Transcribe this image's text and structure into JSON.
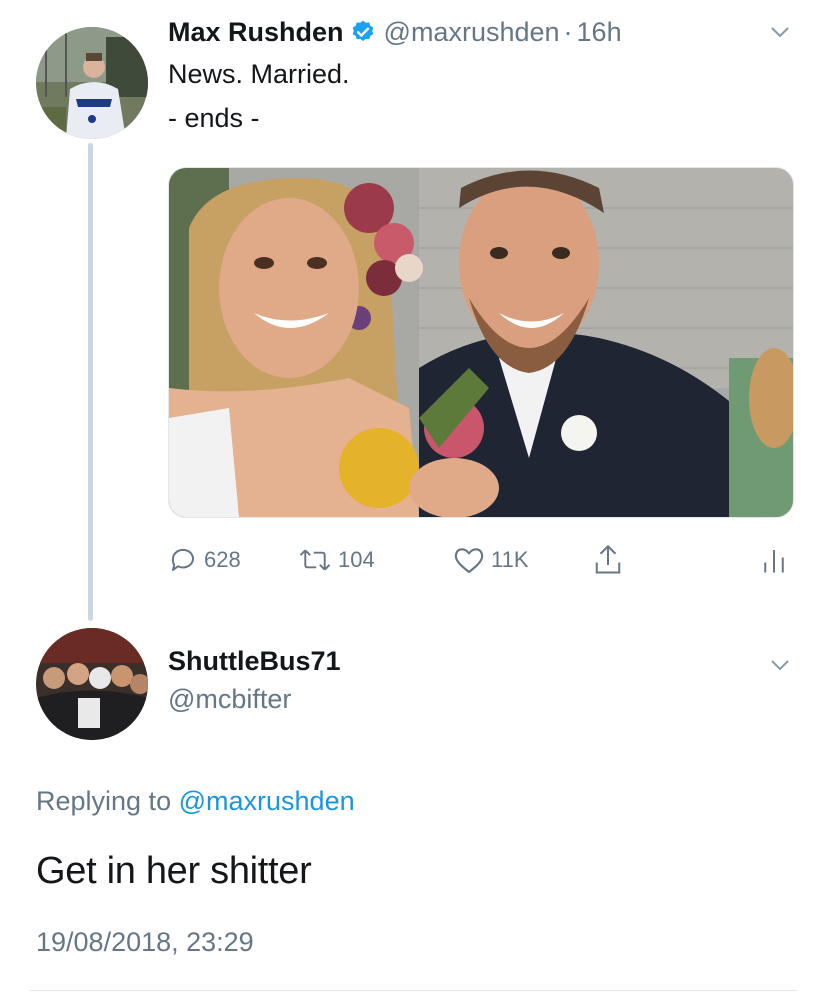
{
  "colors": {
    "accent": "#1b95e0",
    "muted": "#657786",
    "text": "#14171a",
    "divider": "#e1e8ed",
    "verified": "#1da1f2"
  },
  "tweet": {
    "author_name": "Max Rushden",
    "verified": true,
    "handle": "@maxrushden",
    "separator": "·",
    "time": "16h",
    "text_line1": "News. Married.",
    "text_line2": "- ends -",
    "photo_icon": "wedding-selfie-photo",
    "actions": {
      "reply_count": "628",
      "retweet_count": "104",
      "like_count": "11K"
    }
  },
  "reply": {
    "author_name": "ShuttleBus71",
    "handle": "@mcbifter",
    "replying_prefix": "Replying to",
    "replying_handle": "@maxrushden",
    "text": "Get in her shitter",
    "timestamp": "19/08/2018, 23:29"
  }
}
